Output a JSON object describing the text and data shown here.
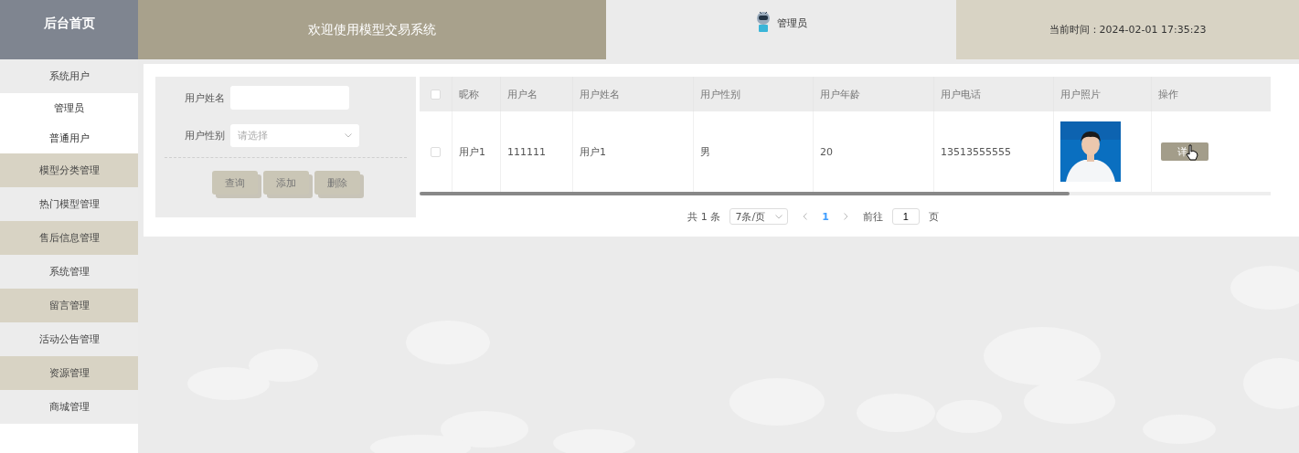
{
  "sidebar": {
    "title": "后台首页",
    "items": [
      {
        "label": "系统用户",
        "children": [
          {
            "label": "管理员"
          },
          {
            "label": "普通用户"
          }
        ]
      },
      {
        "label": "模型分类管理"
      },
      {
        "label": "热门模型管理"
      },
      {
        "label": "售后信息管理"
      },
      {
        "label": "系统管理"
      },
      {
        "label": "留言管理"
      },
      {
        "label": "活动公告管理"
      },
      {
        "label": "资源管理"
      },
      {
        "label": "商城管理"
      }
    ]
  },
  "header": {
    "title": "欢迎使用模型交易系统",
    "user": "管理员",
    "time": "当前时间：2024-02-01 17:35:23"
  },
  "search": {
    "fields": [
      {
        "label": "用户姓名",
        "kind": "text"
      },
      {
        "label": "用户性别",
        "kind": "select",
        "placeholder": "请选择"
      }
    ],
    "buttons": [
      "查询",
      "添加",
      "删除"
    ]
  },
  "table": {
    "select_all_checked": false,
    "columns": [
      "昵称",
      "用户名",
      "用户姓名",
      "用户性别",
      "用户年龄",
      "用户电话",
      "用户照片",
      "操作"
    ],
    "rows": [
      {
        "checked": false,
        "cells": [
          "用户1",
          "111111",
          "用户1",
          "男",
          "20",
          "13513555555"
        ],
        "action": "详"
      }
    ]
  },
  "pagination": {
    "total": "共 1 条",
    "page_size": "7条/页",
    "pages": [
      {
        "label": "1",
        "selected": true
      }
    ],
    "goto_label": "前往",
    "goto_value": "1",
    "page_unit": "页"
  }
}
